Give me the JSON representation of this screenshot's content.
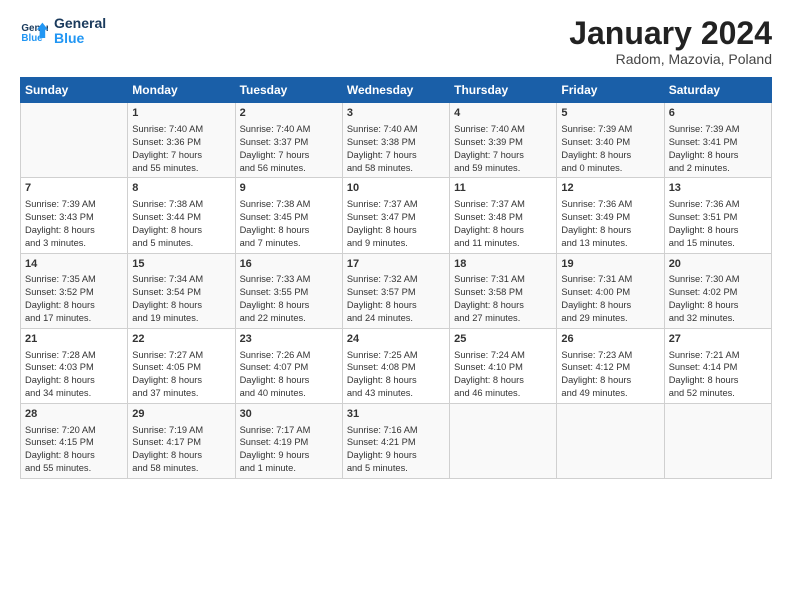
{
  "header": {
    "logo_line1": "General",
    "logo_line2": "Blue",
    "main_title": "January 2024",
    "subtitle": "Radom, Mazovia, Poland"
  },
  "days_of_week": [
    "Sunday",
    "Monday",
    "Tuesday",
    "Wednesday",
    "Thursday",
    "Friday",
    "Saturday"
  ],
  "weeks": [
    [
      {
        "day": "",
        "content": ""
      },
      {
        "day": "1",
        "content": "Sunrise: 7:40 AM\nSunset: 3:36 PM\nDaylight: 7 hours\nand 55 minutes."
      },
      {
        "day": "2",
        "content": "Sunrise: 7:40 AM\nSunset: 3:37 PM\nDaylight: 7 hours\nand 56 minutes."
      },
      {
        "day": "3",
        "content": "Sunrise: 7:40 AM\nSunset: 3:38 PM\nDaylight: 7 hours\nand 58 minutes."
      },
      {
        "day": "4",
        "content": "Sunrise: 7:40 AM\nSunset: 3:39 PM\nDaylight: 7 hours\nand 59 minutes."
      },
      {
        "day": "5",
        "content": "Sunrise: 7:39 AM\nSunset: 3:40 PM\nDaylight: 8 hours\nand 0 minutes."
      },
      {
        "day": "6",
        "content": "Sunrise: 7:39 AM\nSunset: 3:41 PM\nDaylight: 8 hours\nand 2 minutes."
      }
    ],
    [
      {
        "day": "7",
        "content": "Sunrise: 7:39 AM\nSunset: 3:43 PM\nDaylight: 8 hours\nand 3 minutes."
      },
      {
        "day": "8",
        "content": "Sunrise: 7:38 AM\nSunset: 3:44 PM\nDaylight: 8 hours\nand 5 minutes."
      },
      {
        "day": "9",
        "content": "Sunrise: 7:38 AM\nSunset: 3:45 PM\nDaylight: 8 hours\nand 7 minutes."
      },
      {
        "day": "10",
        "content": "Sunrise: 7:37 AM\nSunset: 3:47 PM\nDaylight: 8 hours\nand 9 minutes."
      },
      {
        "day": "11",
        "content": "Sunrise: 7:37 AM\nSunset: 3:48 PM\nDaylight: 8 hours\nand 11 minutes."
      },
      {
        "day": "12",
        "content": "Sunrise: 7:36 AM\nSunset: 3:49 PM\nDaylight: 8 hours\nand 13 minutes."
      },
      {
        "day": "13",
        "content": "Sunrise: 7:36 AM\nSunset: 3:51 PM\nDaylight: 8 hours\nand 15 minutes."
      }
    ],
    [
      {
        "day": "14",
        "content": "Sunrise: 7:35 AM\nSunset: 3:52 PM\nDaylight: 8 hours\nand 17 minutes."
      },
      {
        "day": "15",
        "content": "Sunrise: 7:34 AM\nSunset: 3:54 PM\nDaylight: 8 hours\nand 19 minutes."
      },
      {
        "day": "16",
        "content": "Sunrise: 7:33 AM\nSunset: 3:55 PM\nDaylight: 8 hours\nand 22 minutes."
      },
      {
        "day": "17",
        "content": "Sunrise: 7:32 AM\nSunset: 3:57 PM\nDaylight: 8 hours\nand 24 minutes."
      },
      {
        "day": "18",
        "content": "Sunrise: 7:31 AM\nSunset: 3:58 PM\nDaylight: 8 hours\nand 27 minutes."
      },
      {
        "day": "19",
        "content": "Sunrise: 7:31 AM\nSunset: 4:00 PM\nDaylight: 8 hours\nand 29 minutes."
      },
      {
        "day": "20",
        "content": "Sunrise: 7:30 AM\nSunset: 4:02 PM\nDaylight: 8 hours\nand 32 minutes."
      }
    ],
    [
      {
        "day": "21",
        "content": "Sunrise: 7:28 AM\nSunset: 4:03 PM\nDaylight: 8 hours\nand 34 minutes."
      },
      {
        "day": "22",
        "content": "Sunrise: 7:27 AM\nSunset: 4:05 PM\nDaylight: 8 hours\nand 37 minutes."
      },
      {
        "day": "23",
        "content": "Sunrise: 7:26 AM\nSunset: 4:07 PM\nDaylight: 8 hours\nand 40 minutes."
      },
      {
        "day": "24",
        "content": "Sunrise: 7:25 AM\nSunset: 4:08 PM\nDaylight: 8 hours\nand 43 minutes."
      },
      {
        "day": "25",
        "content": "Sunrise: 7:24 AM\nSunset: 4:10 PM\nDaylight: 8 hours\nand 46 minutes."
      },
      {
        "day": "26",
        "content": "Sunrise: 7:23 AM\nSunset: 4:12 PM\nDaylight: 8 hours\nand 49 minutes."
      },
      {
        "day": "27",
        "content": "Sunrise: 7:21 AM\nSunset: 4:14 PM\nDaylight: 8 hours\nand 52 minutes."
      }
    ],
    [
      {
        "day": "28",
        "content": "Sunrise: 7:20 AM\nSunset: 4:15 PM\nDaylight: 8 hours\nand 55 minutes."
      },
      {
        "day": "29",
        "content": "Sunrise: 7:19 AM\nSunset: 4:17 PM\nDaylight: 8 hours\nand 58 minutes."
      },
      {
        "day": "30",
        "content": "Sunrise: 7:17 AM\nSunset: 4:19 PM\nDaylight: 9 hours\nand 1 minute."
      },
      {
        "day": "31",
        "content": "Sunrise: 7:16 AM\nSunset: 4:21 PM\nDaylight: 9 hours\nand 5 minutes."
      },
      {
        "day": "",
        "content": ""
      },
      {
        "day": "",
        "content": ""
      },
      {
        "day": "",
        "content": ""
      }
    ]
  ]
}
